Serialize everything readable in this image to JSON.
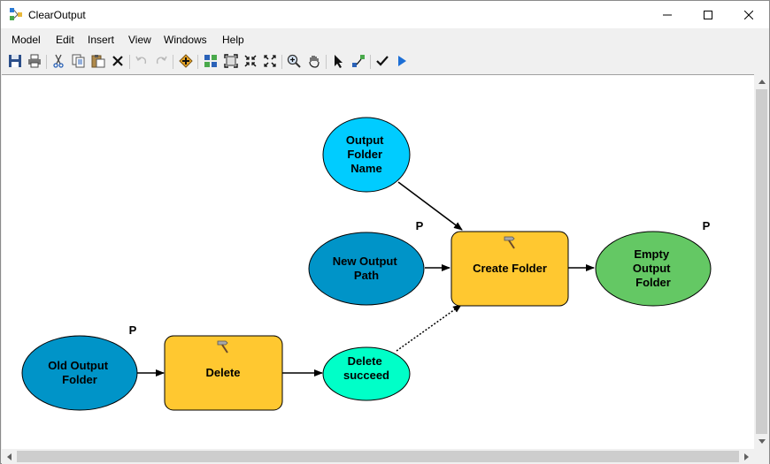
{
  "window": {
    "title": "ClearOutput"
  },
  "menu": {
    "items": [
      "Model",
      "Edit",
      "Insert",
      "View",
      "Windows",
      "Help"
    ]
  },
  "toolbar": {
    "icons": [
      "save-icon",
      "print-icon",
      "cut-icon",
      "copy-icon",
      "paste-icon",
      "delete-icon",
      "undo-icon",
      "redo-icon",
      "add-data-icon",
      "auto-layout-icon",
      "full-extent-icon",
      "zoom-in-fixed-icon",
      "zoom-out-fixed-icon",
      "zoom-icon",
      "pan-icon",
      "select-icon",
      "connect-icon",
      "validate-icon",
      "run-icon"
    ]
  },
  "model": {
    "nodes": {
      "output_folder_name": {
        "lines": [
          "Output",
          "Folder",
          "Name"
        ],
        "color": "#00CCFF"
      },
      "new_output_path": {
        "lines": [
          "New Output",
          "Path"
        ],
        "color": "#0094C8"
      },
      "create_folder": {
        "lines": [
          "Create Folder"
        ],
        "color": "#FFC830"
      },
      "empty_output_folder": {
        "lines": [
          "Empty",
          "Output",
          "Folder"
        ],
        "color": "#64C864"
      },
      "old_output_folder": {
        "lines": [
          "Old Output",
          "Folder"
        ],
        "color": "#0094C8"
      },
      "delete": {
        "lines": [
          "Delete"
        ],
        "color": "#FFC830"
      },
      "delete_succeed": {
        "lines": [
          "Delete",
          "succeed"
        ],
        "color": "#00FFC8"
      }
    },
    "parameter_marker": "P"
  }
}
